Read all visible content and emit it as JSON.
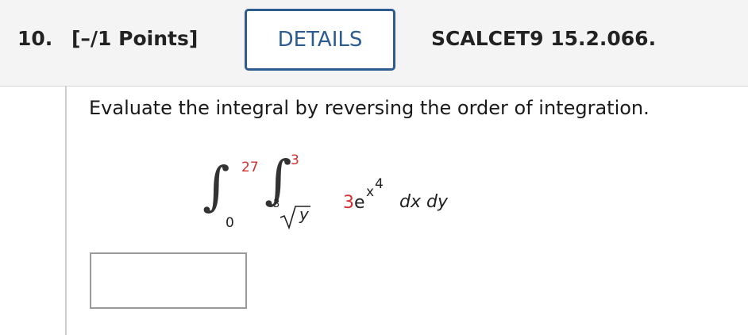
{
  "header": {
    "question_number": "10.",
    "points": "[–/1 Points]",
    "details_label": "DETAILS",
    "course_code": "SCALCET9 15.2.066."
  },
  "question": {
    "prompt": "Evaluate the integral by reversing the order of integration.",
    "integral": {
      "outer_upper": "27",
      "outer_lower": "0",
      "inner_upper": "3",
      "inner_lower_root_index": "3",
      "inner_lower_radicand": "y",
      "integrand_coefficient": "3",
      "integrand_base": "e",
      "integrand_exponent_base": "x",
      "integrand_exponent_power": "4",
      "differentials": "dx dy"
    },
    "answer_value": ""
  }
}
